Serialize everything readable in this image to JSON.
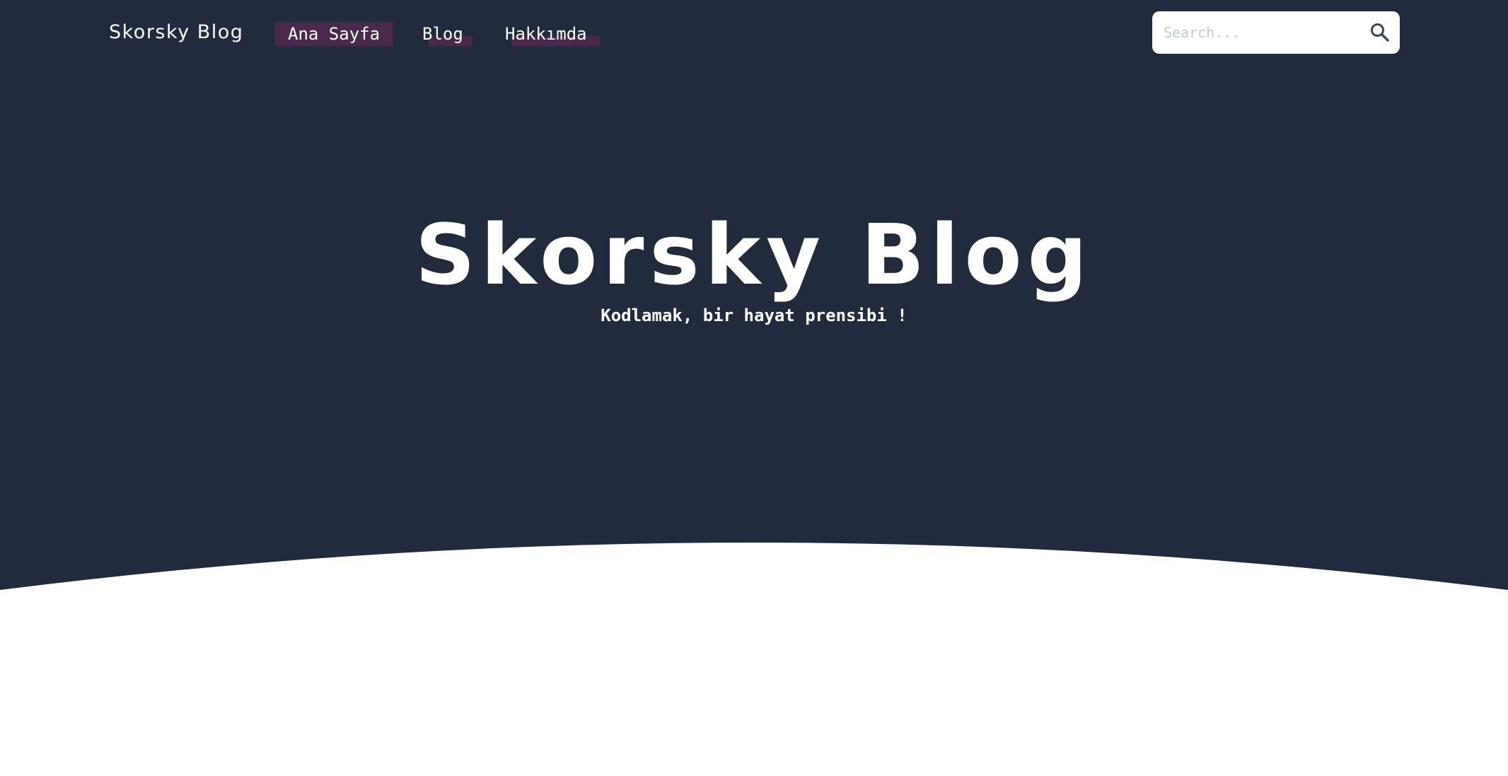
{
  "colors": {
    "header_background": "#222b3e",
    "nav_highlight": "#4a2a4c",
    "page_background": "#ffffff",
    "text_light": "#ffffff"
  },
  "navbar": {
    "brand": "Skorsky Blog",
    "links": [
      {
        "label": "Ana Sayfa",
        "active": true
      },
      {
        "label": "Blog",
        "active": false
      },
      {
        "label": "Hakkımda",
        "active": false
      }
    ],
    "search": {
      "placeholder": "Search...",
      "value": "",
      "icon": "search-icon"
    }
  },
  "hero": {
    "title": "Skorsky Blog",
    "subtitle": "Kodlamak, bir hayat prensibi !"
  }
}
